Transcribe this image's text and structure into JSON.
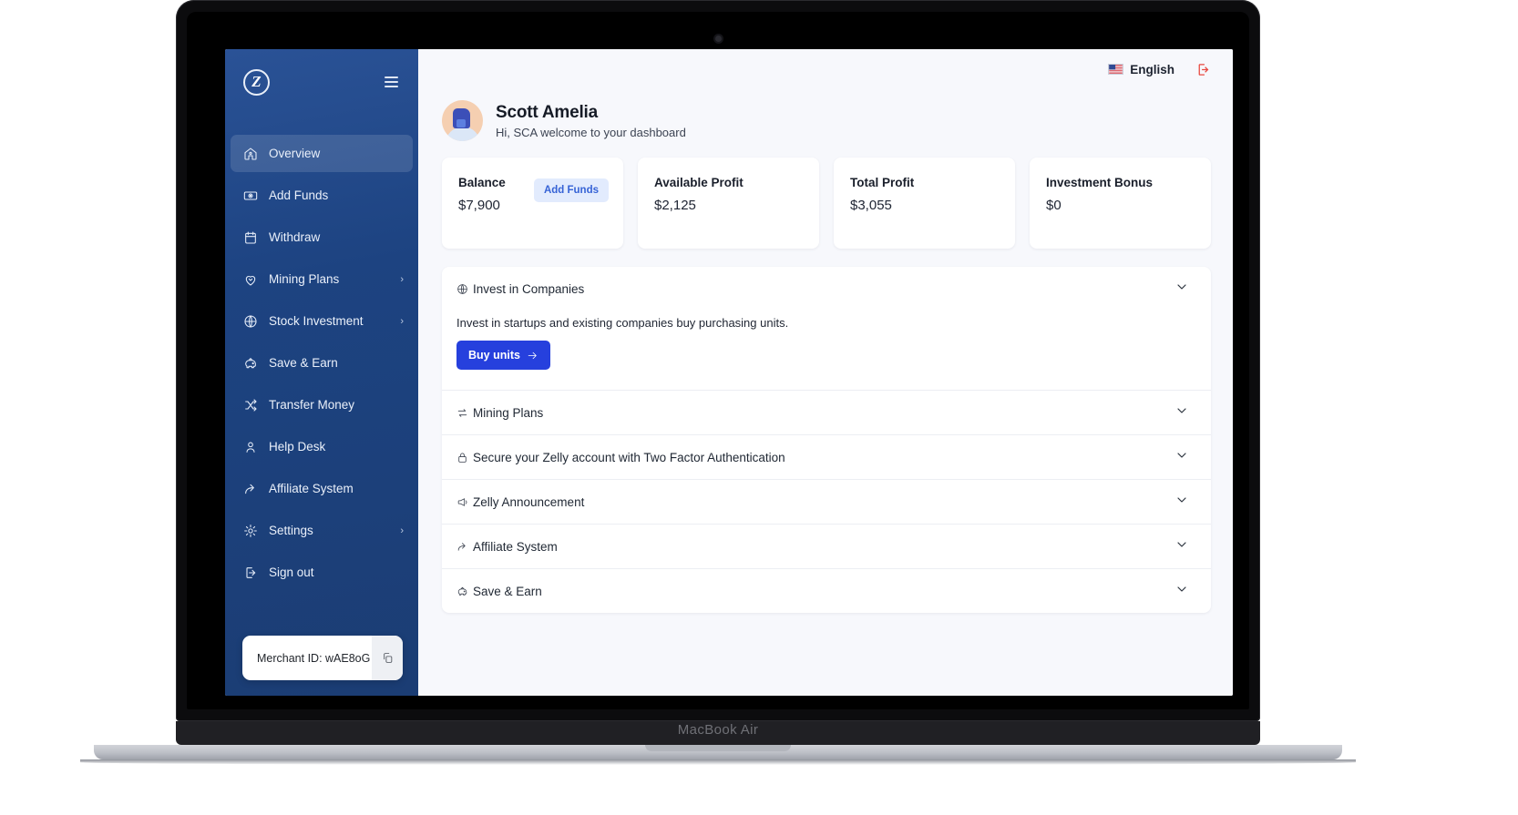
{
  "device": {
    "label": "MacBook Air"
  },
  "sidebar": {
    "logo_letter": "Z",
    "menu_icon": "hamburger-icon",
    "items": [
      {
        "label": "Overview",
        "icon": "home-icon",
        "active": true,
        "chevron": ""
      },
      {
        "label": "Add Funds",
        "icon": "money-icon",
        "active": false,
        "chevron": ""
      },
      {
        "label": "Withdraw",
        "icon": "calendar-icon",
        "active": false,
        "chevron": ""
      },
      {
        "label": "Mining Plans",
        "icon": "gem-icon",
        "active": false,
        "chevron": "›"
      },
      {
        "label": "Stock Investment",
        "icon": "globe-icon",
        "active": false,
        "chevron": "›"
      },
      {
        "label": "Save & Earn",
        "icon": "piggy-icon",
        "active": false,
        "chevron": ""
      },
      {
        "label": "Transfer Money",
        "icon": "shuffle-icon",
        "active": false,
        "chevron": ""
      },
      {
        "label": "Help Desk",
        "icon": "user-icon",
        "active": false,
        "chevron": ""
      },
      {
        "label": "Affiliate System",
        "icon": "share-icon",
        "active": false,
        "chevron": ""
      },
      {
        "label": "Settings",
        "icon": "gear-icon",
        "active": false,
        "chevron": "›"
      },
      {
        "label": "Sign out",
        "icon": "signout-icon",
        "active": false,
        "chevron": ""
      }
    ],
    "merchant": {
      "label": "Merchant ID: wAE8oG",
      "copy_icon": "copy-icon"
    }
  },
  "topbar": {
    "language": "English",
    "flag_icon": "us-flag-icon",
    "logout_icon": "logout-icon"
  },
  "profile": {
    "name": "Scott Amelia",
    "greeting": "Hi, SCA welcome to your dashboard",
    "avatar": "user-avatar"
  },
  "stats": [
    {
      "title": "Balance",
      "value": "$7,900",
      "action": "Add Funds"
    },
    {
      "title": "Available Profit",
      "value": "$2,125",
      "action": ""
    },
    {
      "title": "Total Profit",
      "value": "$3,055",
      "action": ""
    },
    {
      "title": "Investment Bonus",
      "value": "$0",
      "action": ""
    }
  ],
  "accordion": [
    {
      "title": "Invest in Companies",
      "icon": "globe-icon",
      "expanded": true,
      "description": "Invest in startups and existing companies buy purchasing units.",
      "cta": "Buy units",
      "cta_icon": "arrow-right-icon"
    },
    {
      "title": "Mining Plans",
      "icon": "exchange-icon",
      "expanded": false
    },
    {
      "title": "Secure your Zelly  account with Two Factor Authentication",
      "icon": "lock-icon",
      "expanded": false
    },
    {
      "title": "Zelly Announcement",
      "icon": "megaphone-icon",
      "expanded": false
    },
    {
      "title": "Affiliate System",
      "icon": "share-icon",
      "expanded": false
    },
    {
      "title": "Save & Earn",
      "icon": "piggy-icon",
      "expanded": false
    }
  ],
  "colors": {
    "sidebar_top": "#2a5296",
    "sidebar_bottom": "#1b3d74",
    "accent_blue": "#2640dd",
    "chip_blue": "#e2ebfd",
    "chip_text": "#3663d6",
    "logout_red": "#e8483f",
    "page_bg": "#f7f8fc"
  }
}
